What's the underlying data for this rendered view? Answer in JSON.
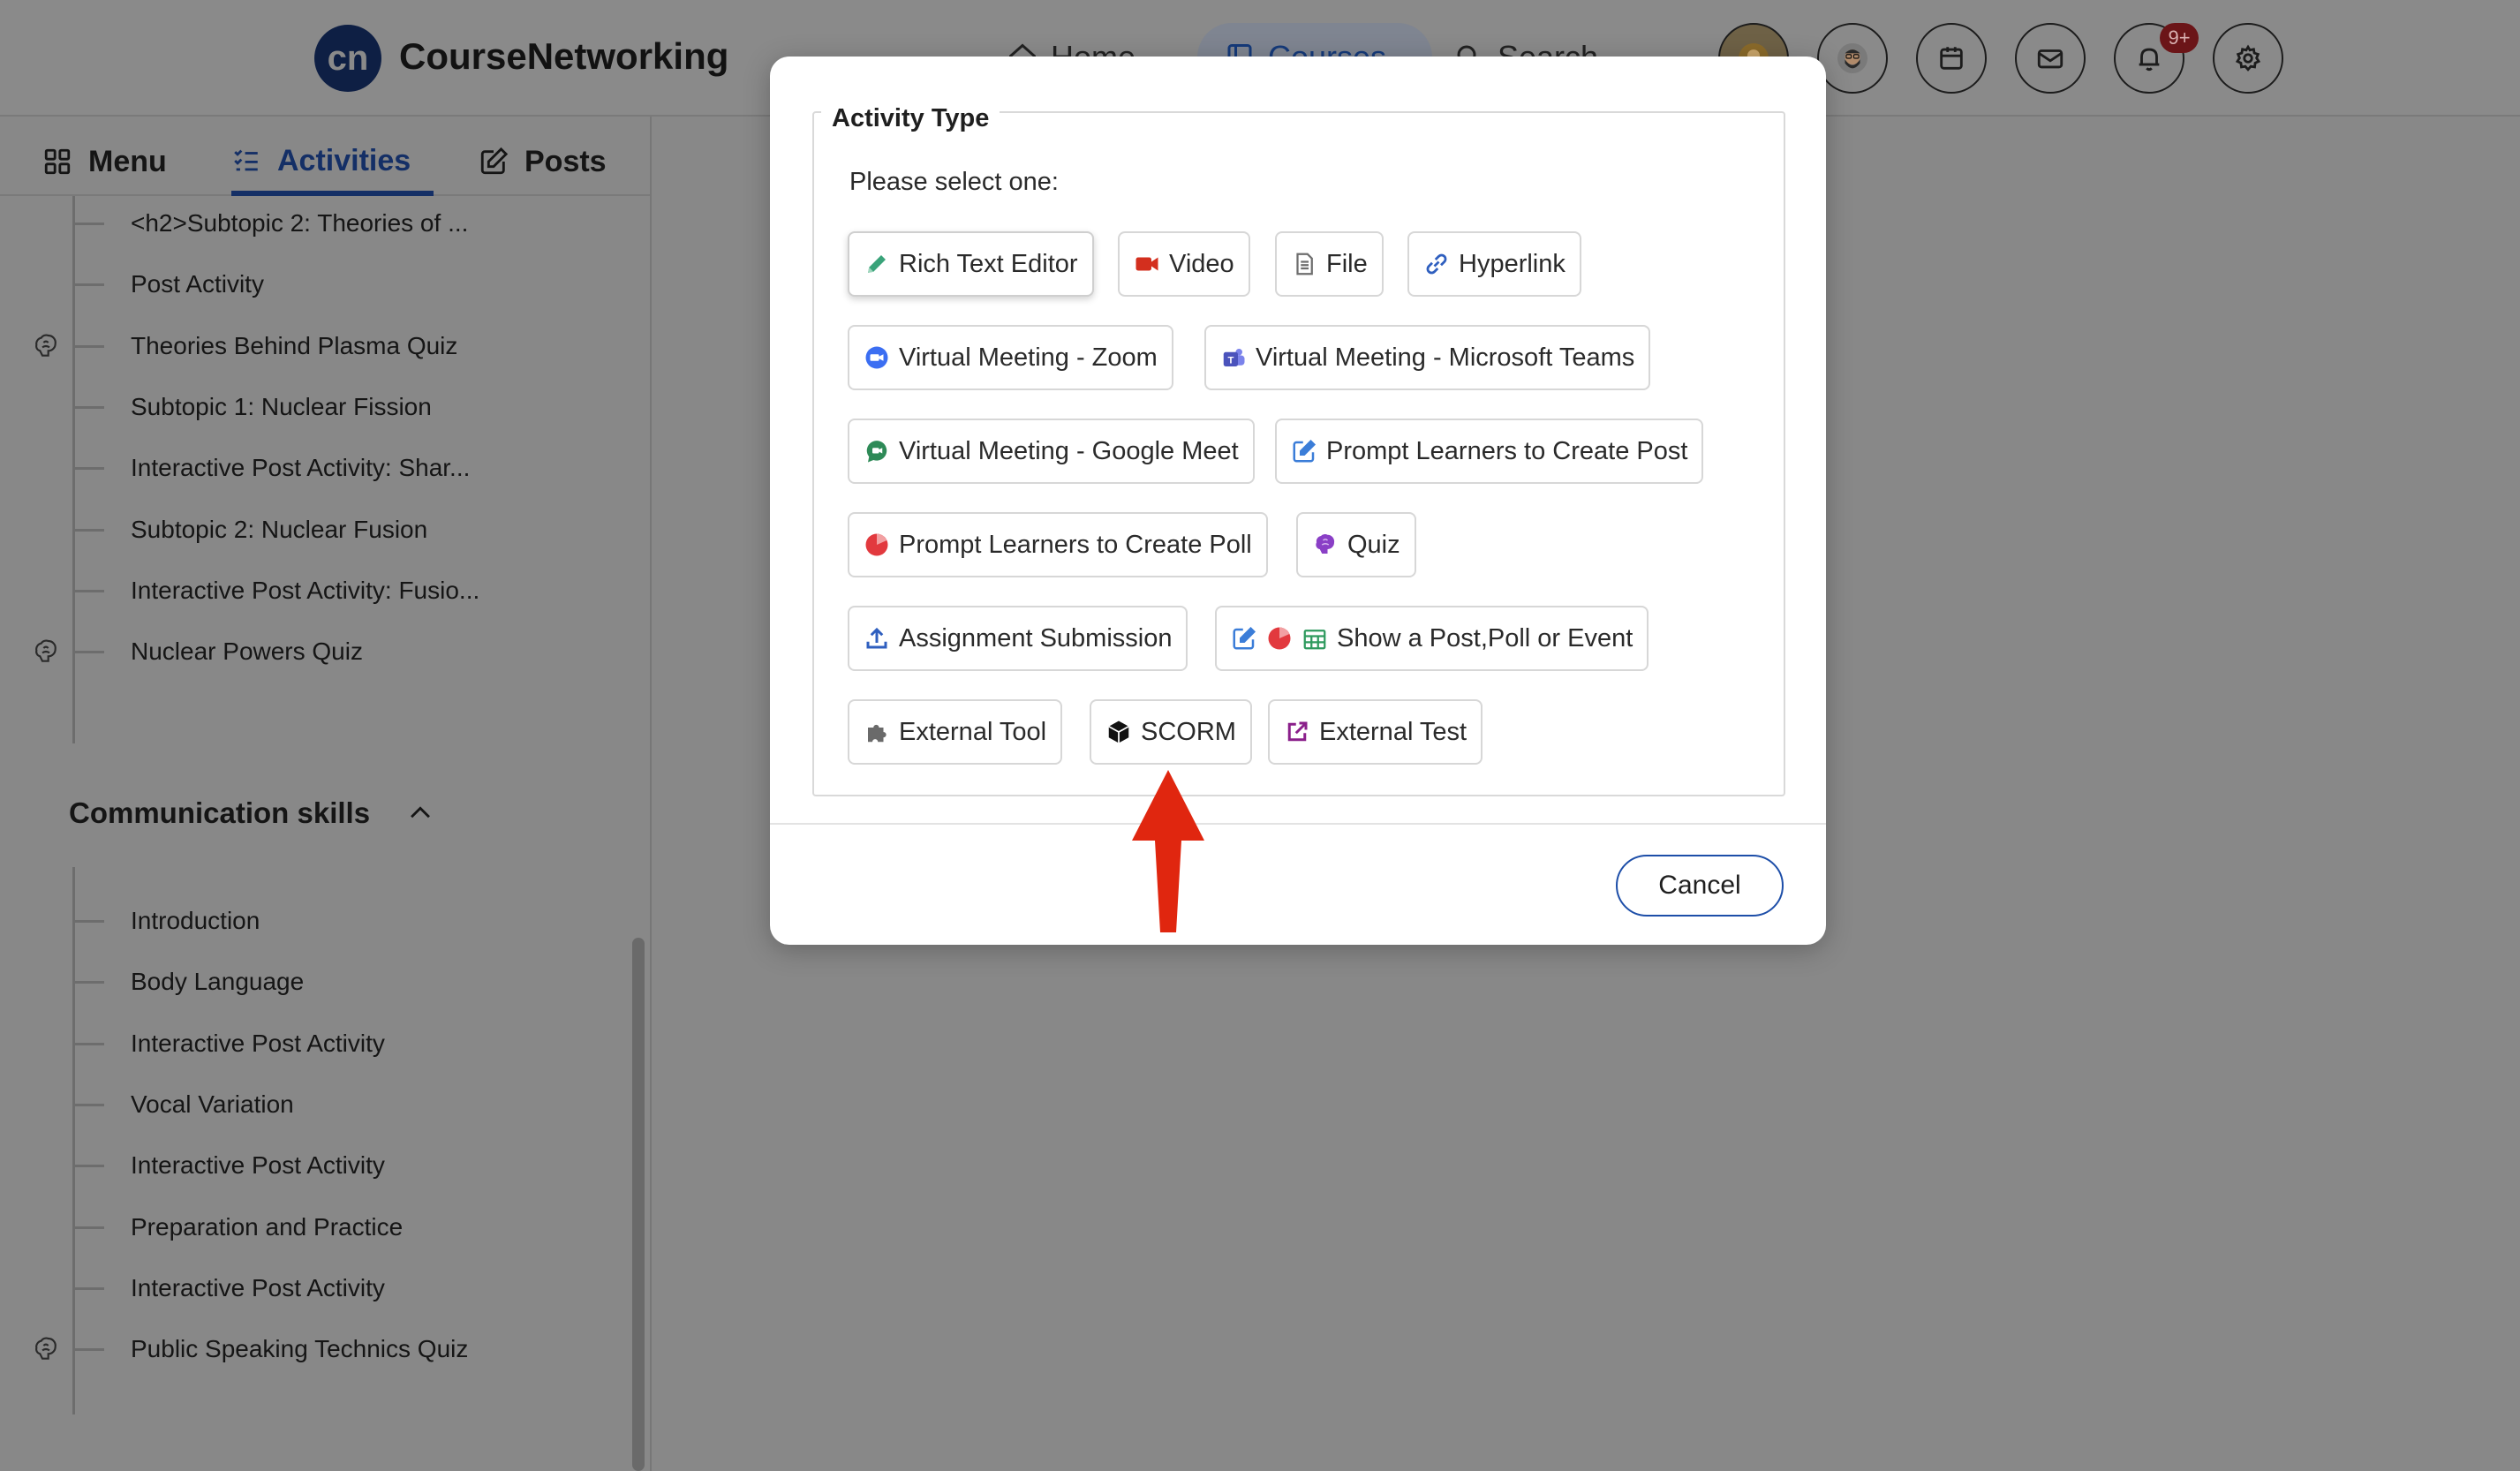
{
  "header": {
    "logo_text": "cn",
    "brand": "CourseNetworking",
    "nav": {
      "home": "Home",
      "courses": "Courses",
      "search": "Search"
    },
    "notification_badge": "9+"
  },
  "sidebar": {
    "tabs": {
      "menu": "Menu",
      "activities": "Activities",
      "posts": "Posts"
    },
    "items_top": [
      {
        "label": "<h2>Subtopic 2: Theories of ...",
        "quiz": false
      },
      {
        "label": "Post Activity",
        "quiz": false
      },
      {
        "label": "Theories Behind Plasma Quiz",
        "quiz": true
      },
      {
        "label": "Subtopic 1: Nuclear Fission",
        "quiz": false
      },
      {
        "label": "Interactive Post Activity: Shar...",
        "quiz": false
      },
      {
        "label": "Subtopic 2: Nuclear Fusion",
        "quiz": false
      },
      {
        "label": "Interactive Post Activity: Fusio...",
        "quiz": false
      },
      {
        "label": "Nuclear Powers Quiz",
        "quiz": true
      }
    ],
    "section_title": "Communication skills",
    "items_bottom": [
      {
        "label": "Introduction",
        "quiz": false
      },
      {
        "label": "Body Language",
        "quiz": false
      },
      {
        "label": "Interactive Post Activity",
        "quiz": false
      },
      {
        "label": "Vocal Variation",
        "quiz": false
      },
      {
        "label": "Interactive Post Activity",
        "quiz": false
      },
      {
        "label": "Preparation and Practice",
        "quiz": false
      },
      {
        "label": "Interactive Post Activity",
        "quiz": false
      },
      {
        "label": "Public Speaking Technics Quiz",
        "quiz": true
      }
    ]
  },
  "modal": {
    "legend": "Activity Type",
    "prompt": "Please select one:",
    "options": {
      "rich_text_editor": "Rich Text Editor",
      "video": "Video",
      "file": "File",
      "hyperlink": "Hyperlink",
      "zoom": "Virtual Meeting - Zoom",
      "teams": "Virtual Meeting - Microsoft Teams",
      "google_meet": "Virtual Meeting - Google Meet",
      "create_post": "Prompt Learners to Create Post",
      "create_poll": "Prompt Learners to Create Poll",
      "quiz": "Quiz",
      "assignment": "Assignment Submission",
      "show_post": "Show a Post,Poll or Event",
      "external_tool": "External Tool",
      "scorm": "SCORM",
      "external_test": "External Test"
    },
    "cancel": "Cancel"
  },
  "colors": {
    "accent_blue": "#1d4ea8",
    "annotation_arrow": "#e0260f",
    "overlay": "#888888"
  }
}
